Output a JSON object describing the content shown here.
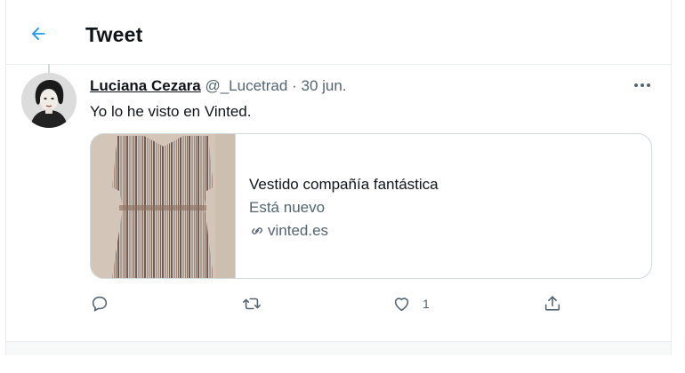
{
  "header": {
    "title": "Tweet",
    "back_icon": "arrow-left-icon"
  },
  "tweet": {
    "author_name": "Luciana Cezara",
    "handle": "@_Lucetrad",
    "separator": "·",
    "date": "30 jun.",
    "text": "Yo lo he visto en Vinted.",
    "more_icon": "more-dots-icon",
    "card": {
      "title": "Vestido compañía fantástica",
      "description": "Está nuevo",
      "domain": "vinted.es",
      "link_icon": "link-icon",
      "image": "striped-dress-photo"
    },
    "actions": {
      "reply": {
        "icon": "reply-icon"
      },
      "retweet": {
        "icon": "retweet-icon"
      },
      "like": {
        "icon": "heart-icon",
        "count": "1"
      },
      "share": {
        "icon": "share-icon"
      }
    }
  },
  "colors": {
    "accent": "#1d9bf0",
    "secondary_text": "#536471",
    "border": "#cfd9de"
  }
}
